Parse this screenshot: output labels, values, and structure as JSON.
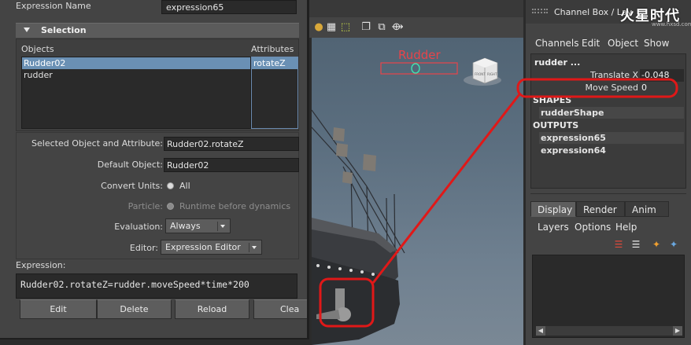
{
  "expression_editor": {
    "name_label": "Expression Name",
    "name_value": "expression65",
    "selection_header": "Selection",
    "objects_label": "Objects",
    "attributes_label": "Attributes",
    "objects": [
      "Rudder02",
      "rudder"
    ],
    "attributes": [
      "rotateZ"
    ],
    "selected_object_label": "Selected Object and Attribute:",
    "selected_object_value": "Rudder02.rotateZ",
    "default_object_label": "Default Object:",
    "default_object_value": "Rudder02",
    "convert_units_label": "Convert Units:",
    "convert_units_option": "All",
    "particle_label": "Particle:",
    "particle_option": "Runtime before dynamics",
    "evaluation_label": "Evaluation:",
    "evaluation_value": "Always",
    "editor_label": "Editor:",
    "editor_value": "Expression Editor",
    "expression_label": "Expression:",
    "expression_text": "Rudder02.rotateZ=rudder.moveSpeed*time*200",
    "buttons": {
      "edit": "Edit",
      "delete": "Delete",
      "reload": "Reload",
      "clear": "Clea"
    }
  },
  "viewport": {
    "object_label": "Rudder",
    "viewcube_front": "FRONT",
    "viewcube_right": "RIGHT",
    "label_color": "#e8444a",
    "highlight_color": "#e01818"
  },
  "channel_box": {
    "title": "Channel Box / Lay",
    "logo_text": "火星时代",
    "logo_url": "www.hxsd.com",
    "menu": [
      "Channels",
      "Edit",
      "Object",
      "Show"
    ],
    "node_name": "rudder ...",
    "attributes": [
      {
        "name": "Translate X",
        "value": "-0.048"
      },
      {
        "name": "Move Speed",
        "value": "0"
      }
    ],
    "shapes_header": "SHAPES",
    "shapes": [
      "rudderShape"
    ],
    "outputs_header": "OUTPUTS",
    "outputs": [
      "expression65",
      "expression64"
    ]
  },
  "layer_editor": {
    "tabs": [
      "Display",
      "Render",
      "Anim"
    ],
    "active_tab": "Display",
    "menu": [
      "Layers",
      "Options",
      "Help"
    ]
  }
}
